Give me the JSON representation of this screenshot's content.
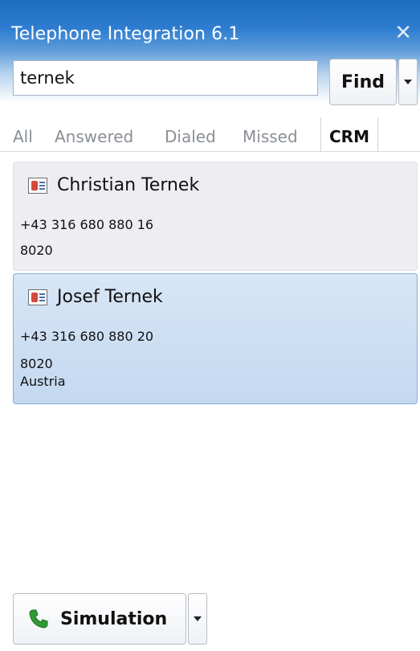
{
  "window": {
    "title": "Telephone Integration 6.1",
    "close_icon": "close-icon",
    "colors": {
      "titlebar_blue": "#1d6cc0",
      "selected_card": "#c3d8f0"
    }
  },
  "search": {
    "value": "ternek",
    "find_label": "Find"
  },
  "tabs": [
    {
      "label": "All",
      "active": false
    },
    {
      "label": "Answered",
      "active": false
    },
    {
      "label": "Dialed",
      "active": false
    },
    {
      "label": "Missed",
      "active": false
    },
    {
      "label": "CRM",
      "active": true
    }
  ],
  "results": [
    {
      "icon": "contact-card-icon",
      "name": "Christian Ternek",
      "phone": "+43 316 680 880 16",
      "postal_code": "8020",
      "country": "",
      "selected": false
    },
    {
      "icon": "contact-card-icon",
      "name": "Josef Ternek",
      "phone": "+43 316 680 880 20",
      "postal_code": "8020",
      "country": "Austria",
      "selected": true
    }
  ],
  "footer": {
    "simulation_label": "Simulation",
    "simulation_icon": "phone-icon"
  }
}
